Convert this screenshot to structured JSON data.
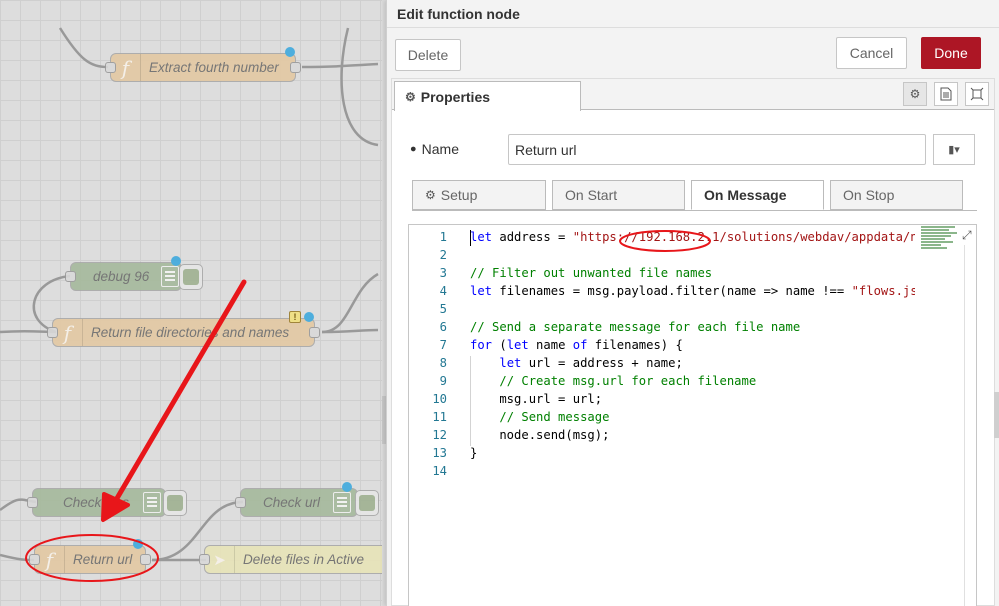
{
  "canvas": {
    "nodes": [
      {
        "name": "function-node-extract-fourth",
        "type": "function",
        "label": "Extract fourth number"
      },
      {
        "name": "debug-node-96",
        "type": "debug",
        "label": "debug 96"
      },
      {
        "name": "function-node-return-file-dirs",
        "type": "function",
        "label": "Return file directories and names"
      },
      {
        "name": "debug-node-check-files",
        "type": "debug",
        "label": "Check files"
      },
      {
        "name": "debug-node-check-url",
        "type": "debug",
        "label": "Check url"
      },
      {
        "name": "function-node-return-url",
        "type": "function",
        "label": "Return url"
      },
      {
        "name": "node-delete-files",
        "type": "other",
        "label": "Delete files in Active"
      }
    ],
    "function_icon": "f",
    "warning_badge": "!"
  },
  "tray": {
    "title": "Edit function node",
    "delete_label": "Delete",
    "cancel_label": "Cancel",
    "done_label": "Done",
    "properties_tab": "Properties",
    "name_label": "Name",
    "name_value": "Return url",
    "subtabs": [
      "Setup",
      "On Start",
      "On Message",
      "On Stop"
    ],
    "active_subtab": "On Message"
  },
  "editor": {
    "line_numbers": [
      "1",
      "2",
      "3",
      "4",
      "5",
      "6",
      "7",
      "8",
      "9",
      "10",
      "11",
      "12",
      "13",
      "14"
    ],
    "lines": [
      [
        [
          "k",
          "let"
        ],
        [
          "p",
          " address = "
        ],
        [
          "s",
          "\"https://192.168.2.1/solutions/webdav/appdata/n"
        ]
      ],
      [],
      [
        [
          "c",
          "// Filter out unwanted file names"
        ]
      ],
      [
        [
          "k",
          "let"
        ],
        [
          "p",
          " filenames = msg.payload.filter(name => name !== "
        ],
        [
          "s",
          "\"flows.js"
        ]
      ],
      [],
      [
        [
          "c",
          "// Send a separate message for each file name"
        ]
      ],
      [
        [
          "k",
          "for"
        ],
        [
          "p",
          " ("
        ],
        [
          "k",
          "let"
        ],
        [
          "p",
          " name "
        ],
        [
          "k",
          "of"
        ],
        [
          "p",
          " filenames) {"
        ]
      ],
      [
        [
          "p",
          "    "
        ],
        [
          "k",
          "let"
        ],
        [
          "p",
          " url = address + name;"
        ]
      ],
      [
        [
          "p",
          "    "
        ],
        [
          "c",
          "// Create msg.url for each filename"
        ]
      ],
      [
        [
          "p",
          "    msg.url = url;"
        ]
      ],
      [
        [
          "p",
          "    "
        ],
        [
          "c",
          "// Send message"
        ]
      ],
      [
        [
          "p",
          "    node.send(msg);"
        ]
      ],
      [
        [
          "p",
          "}"
        ]
      ],
      []
    ]
  },
  "colors": {
    "done": "#ad1625",
    "function_node": "#e3c9a3",
    "debug_node": "#a5b99c",
    "annotation_red": "#e8161a",
    "status_dot": "#3fa9dd"
  },
  "icons": [
    "function-icon",
    "list-icon",
    "gear-icon",
    "document-icon",
    "frame-icon",
    "tag-icon",
    "book-icon",
    "expand-icon",
    "arrow-icon"
  ]
}
